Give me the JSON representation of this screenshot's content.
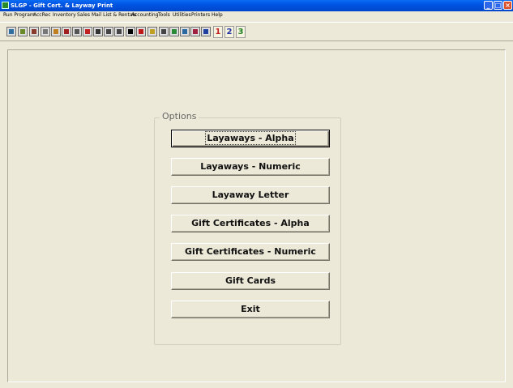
{
  "window": {
    "title": "SLGP - Gift Cert. & Layway Print",
    "minimize_glyph": "_",
    "maximize_glyph": "□",
    "close_glyph": "×"
  },
  "menu": [
    {
      "label": "Run Program"
    },
    {
      "label": "AccRec"
    },
    {
      "label": "Inventory"
    },
    {
      "label": "Sales"
    },
    {
      "label": "Mail List & Rentals"
    },
    {
      "label": "Accounting"
    },
    {
      "label": "Tools"
    },
    {
      "label": "Utilities"
    },
    {
      "label": "Printers"
    },
    {
      "label": "Help"
    }
  ],
  "toolbar": {
    "icons": [
      {
        "name": "monitor-icon",
        "color": "#2f6f9f"
      },
      {
        "name": "edit-icon",
        "color": "#6a8a2a"
      },
      {
        "name": "printer-icon",
        "color": "#8a3a2a"
      },
      {
        "name": "calculator-icon",
        "color": "#777777"
      },
      {
        "name": "clock-icon",
        "color": "#c08020"
      },
      {
        "name": "calendar-icon",
        "color": "#a02020"
      },
      {
        "name": "gear-icon",
        "color": "#555555"
      },
      {
        "name": "pencil-icon",
        "color": "#c02020"
      },
      {
        "name": "binoculars-icon",
        "color": "#333333"
      },
      {
        "name": "scissors-icon",
        "color": "#444444"
      },
      {
        "name": "spelling-icon",
        "color": "#444444"
      },
      {
        "name": "barcode-icon",
        "color": "#000000"
      },
      {
        "name": "stop-icon",
        "color": "#c01818"
      },
      {
        "name": "lock-icon",
        "color": "#c0a020"
      },
      {
        "name": "fax-icon",
        "color": "#444444"
      },
      {
        "name": "chart-icon",
        "color": "#2a8a3a"
      },
      {
        "name": "picture-icon",
        "color": "#2a6aa0"
      },
      {
        "name": "percent-icon",
        "color": "#a02040"
      },
      {
        "name": "globe-icon",
        "color": "#2040a0"
      },
      {
        "name": "help-icon",
        "color": "#c02020"
      }
    ],
    "numbers": [
      "1",
      "2",
      "3"
    ],
    "number_colors": [
      "#c02020",
      "#2030a0",
      "#208020"
    ]
  },
  "options": {
    "legend": "Options",
    "buttons": [
      {
        "label": "Layaways - Alpha"
      },
      {
        "label": "Layaways - Numeric"
      },
      {
        "label": "Layaway Letter"
      },
      {
        "label": "Gift Certificates - Alpha"
      },
      {
        "label": "Gift Certificates - Numeric"
      },
      {
        "label": "Gift Cards"
      },
      {
        "label": "Exit"
      }
    ]
  }
}
